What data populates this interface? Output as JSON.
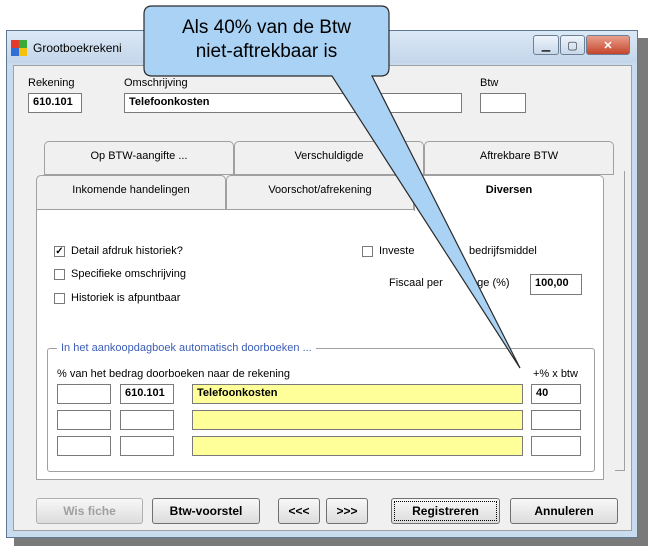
{
  "window": {
    "title": "Grootboekrekeni"
  },
  "header": {
    "rekening_label": "Rekening",
    "rekening_value": "610.101",
    "omschrijving_label": "Omschrijving",
    "omschrijving_value": "Telefoonkosten",
    "btw_label": "Btw",
    "btw_value": ""
  },
  "tabs_back": [
    "Op BTW-aangifte ...",
    "Verschuldigde",
    "Aftrekbare BTW"
  ],
  "tabs_front": [
    "Inkomende handelingen",
    "Voorschot/afrekening",
    "Diversen"
  ],
  "active_tab": "Diversen",
  "diversen": {
    "detail_afdruk": {
      "label": "Detail afdruk historiek?",
      "checked": true
    },
    "specifieke_omschrijving": {
      "label": "Specifieke omschrijving",
      "checked": false
    },
    "historiek_afpuntbaar": {
      "label": "Historiek is afpuntbaar",
      "checked": false
    },
    "investering": {
      "label": "Investe",
      "label2": "bedrijfsmiddel",
      "checked": false
    },
    "fiscaal_label": "Fiscaal per",
    "fiscaal_label2": "tage (%)",
    "fiscaal_value": "100,00"
  },
  "aankoop": {
    "group_label": "In het aankoopdagboek automatisch doorboeken ...",
    "header_left": "% van het bedrag doorboeken naar de rekening",
    "header_right": "+% x btw",
    "rows": [
      {
        "pct": "",
        "rekening": "610.101",
        "omschrijving": "Telefoonkosten",
        "btw": "40"
      },
      {
        "pct": "",
        "rekening": "",
        "omschrijving": "",
        "btw": ""
      },
      {
        "pct": "",
        "rekening": "",
        "omschrijving": "",
        "btw": ""
      }
    ]
  },
  "buttons": {
    "wis_fiche": "Wis fiche",
    "btw_voorstel": "Btw-voorstel",
    "prev": "<<<",
    "next": ">>>",
    "registreren": "Registreren",
    "annuleren": "Annuleren"
  },
  "callout": {
    "line1": "Als 40% van de Btw",
    "line2": "niet-aftrekbaar is"
  },
  "colors": {
    "callout_fill": "#a9d2f5",
    "field_yellow": "#ffff99",
    "window_frame": "#c9dbef"
  }
}
